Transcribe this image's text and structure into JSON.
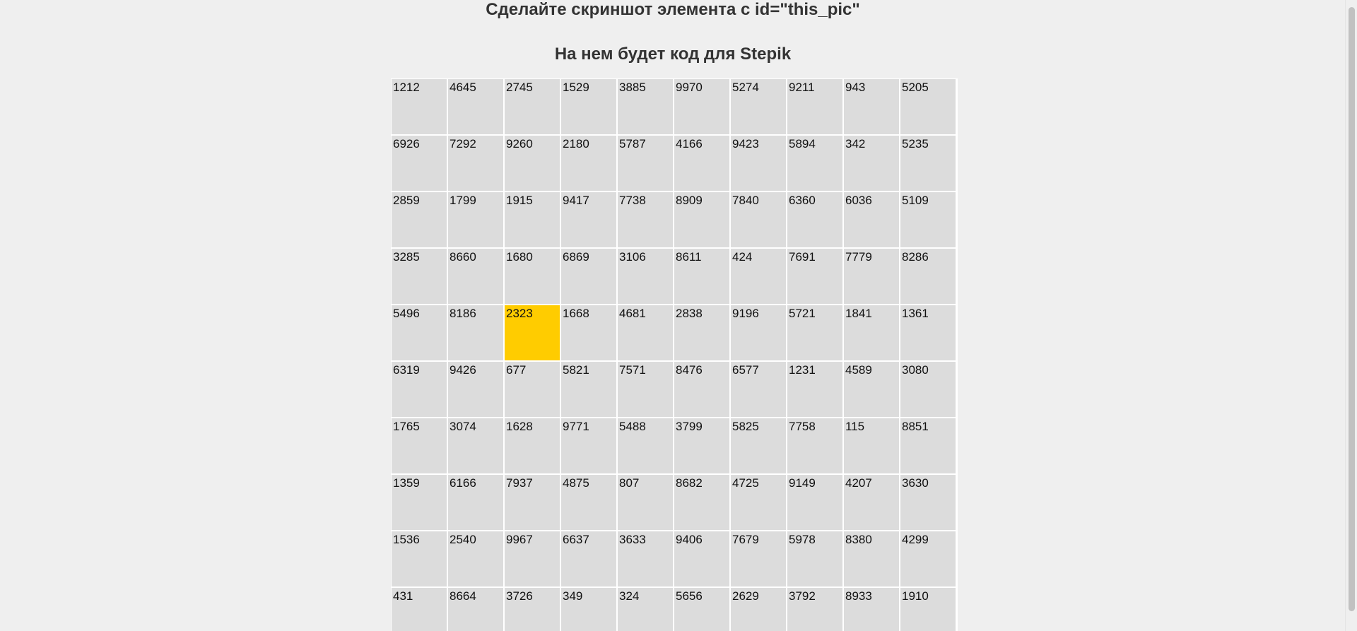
{
  "header": {
    "title": "Сделайте скриншот элемента с id=\"this_pic\"",
    "subtitle": "На нем будет код для Stepik"
  },
  "grid": {
    "highlight_color": "#ffcc00",
    "cell_color": "#dcdcdc",
    "highlighted": [
      4,
      2
    ],
    "rows": [
      [
        "1212",
        "4645",
        "2745",
        "1529",
        "3885",
        "9970",
        "5274",
        "9211",
        "943",
        "5205"
      ],
      [
        "6926",
        "7292",
        "9260",
        "2180",
        "5787",
        "4166",
        "9423",
        "5894",
        "342",
        "5235"
      ],
      [
        "2859",
        "1799",
        "1915",
        "9417",
        "7738",
        "8909",
        "7840",
        "6360",
        "6036",
        "5109"
      ],
      [
        "3285",
        "8660",
        "1680",
        "6869",
        "3106",
        "8611",
        "424",
        "7691",
        "7779",
        "8286"
      ],
      [
        "5496",
        "8186",
        "2323",
        "1668",
        "4681",
        "2838",
        "9196",
        "5721",
        "1841",
        "1361"
      ],
      [
        "6319",
        "9426",
        "677",
        "5821",
        "7571",
        "8476",
        "6577",
        "1231",
        "4589",
        "3080"
      ],
      [
        "1765",
        "3074",
        "1628",
        "9771",
        "5488",
        "3799",
        "5825",
        "7758",
        "115",
        "8851"
      ],
      [
        "1359",
        "6166",
        "7937",
        "4875",
        "807",
        "8682",
        "4725",
        "9149",
        "4207",
        "3630"
      ],
      [
        "1536",
        "2540",
        "9967",
        "6637",
        "3633",
        "9406",
        "7679",
        "5978",
        "8380",
        "4299"
      ],
      [
        "431",
        "8664",
        "3726",
        "349",
        "324",
        "5656",
        "2629",
        "3792",
        "8933",
        "1910"
      ]
    ]
  }
}
